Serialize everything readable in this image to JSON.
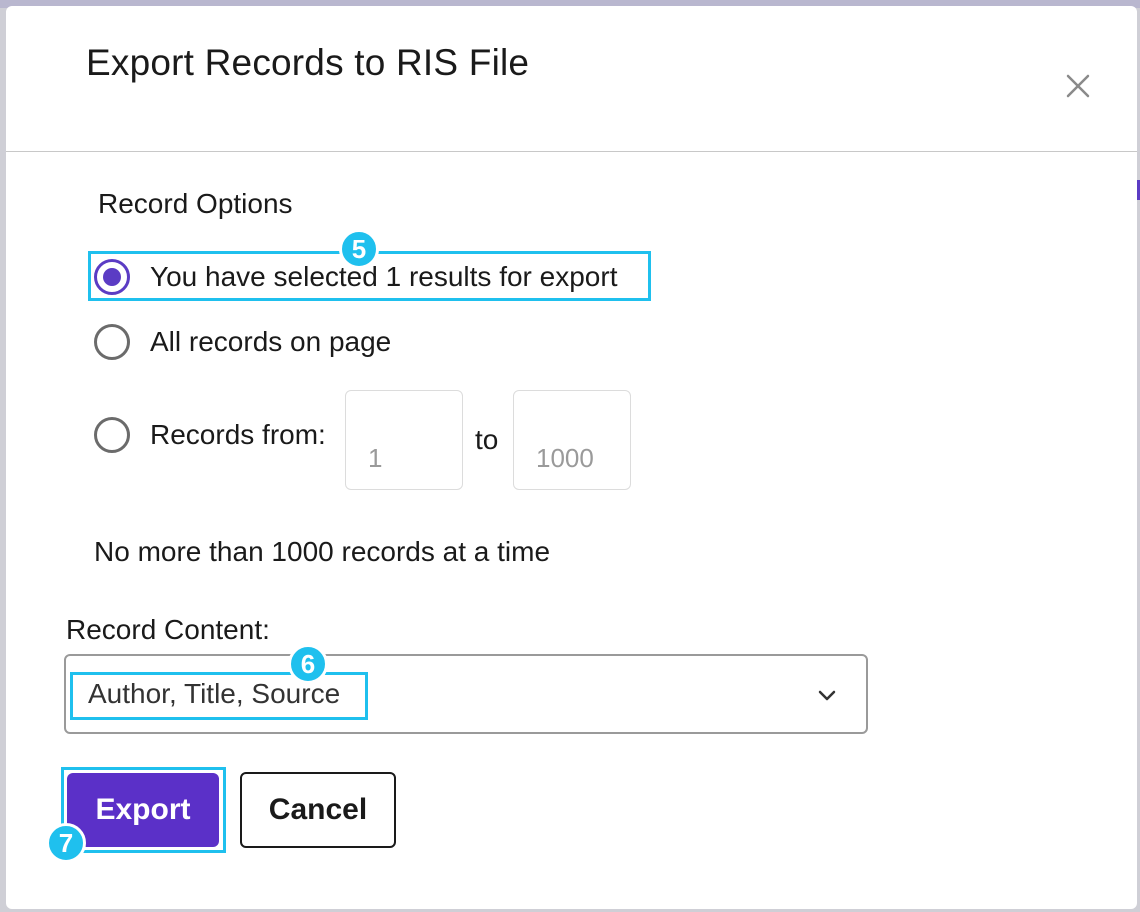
{
  "dialog": {
    "title": "Export Records to RIS File",
    "close_icon": "close-icon"
  },
  "record_options": {
    "label": "Record Options",
    "options": [
      {
        "label": "You have selected 1 results for export",
        "selected": true
      },
      {
        "label": "All records on page",
        "selected": false
      },
      {
        "label": "Records from:",
        "selected": false
      }
    ],
    "range": {
      "from_placeholder": "1",
      "to_label": "to",
      "to_placeholder": "1000"
    },
    "note": "No more than 1000 records at a time"
  },
  "record_content": {
    "label": "Record Content:",
    "selected_value": "Author, Title, Source",
    "chevron_icon": "chevron-down-icon"
  },
  "actions": {
    "export_label": "Export",
    "cancel_label": "Cancel"
  },
  "callouts": {
    "step5": "5",
    "step6": "6",
    "step7": "7"
  },
  "colors": {
    "accent": "#5b30c8",
    "highlight": "#1fc0ee"
  }
}
